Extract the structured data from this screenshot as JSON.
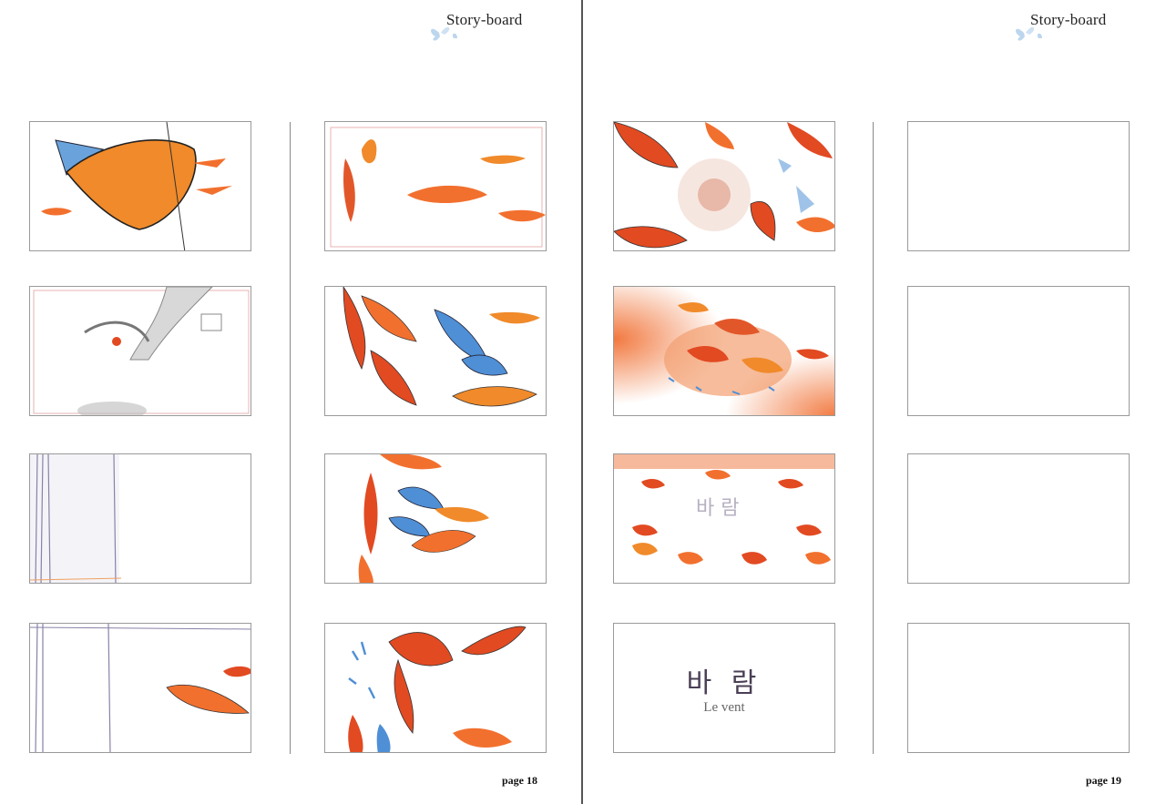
{
  "left_page": {
    "header": "Story-board",
    "page_number": "page 18"
  },
  "right_page": {
    "header": "Story-board",
    "page_number": "page 19"
  },
  "title_card": {
    "korean": "바 람",
    "french": "Le vent"
  },
  "colors": {
    "petal_orange": "#f08a2a",
    "petal_red": "#e24a22",
    "glass_blue": "#4f8fd6",
    "frame_border": "#9a9a9a"
  },
  "icons": [
    "butterfly-icon"
  ]
}
